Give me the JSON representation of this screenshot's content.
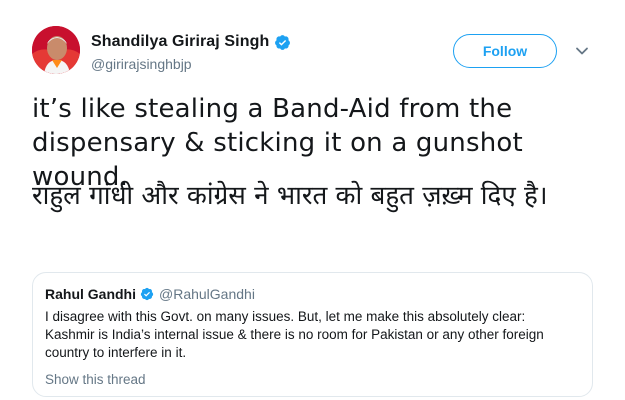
{
  "author": {
    "name": "Shandilya Giriraj Singh",
    "handle": "@girirajsinghbjp",
    "verified": true,
    "avatar_bg": "#c8102e"
  },
  "actions": {
    "follow_label": "Follow",
    "menu_icon": "chevron-down-icon"
  },
  "tweet": {
    "text_en": "it’s like stealing a Band-Aid from the dispensary & sticking it on a gunshot wound.",
    "text_hi": "राहुल गांधी और कांग्रेस ने भारत को बहुत ज़ख़्म दिए है।"
  },
  "quoted_tweet": {
    "name": "Rahul Gandhi",
    "handle": "@RahulGandhi",
    "verified": true,
    "text": "I disagree with this Govt. on many issues. But, let me make this absolutely clear: Kashmir is India’s internal issue & there is no room for Pakistan or any other foreign country to interfere in it.",
    "show_thread_label": "Show this thread"
  },
  "colors": {
    "accent": "#1da1f2",
    "muted": "#657786",
    "border": "#e1e8ed",
    "text": "#14171a"
  }
}
